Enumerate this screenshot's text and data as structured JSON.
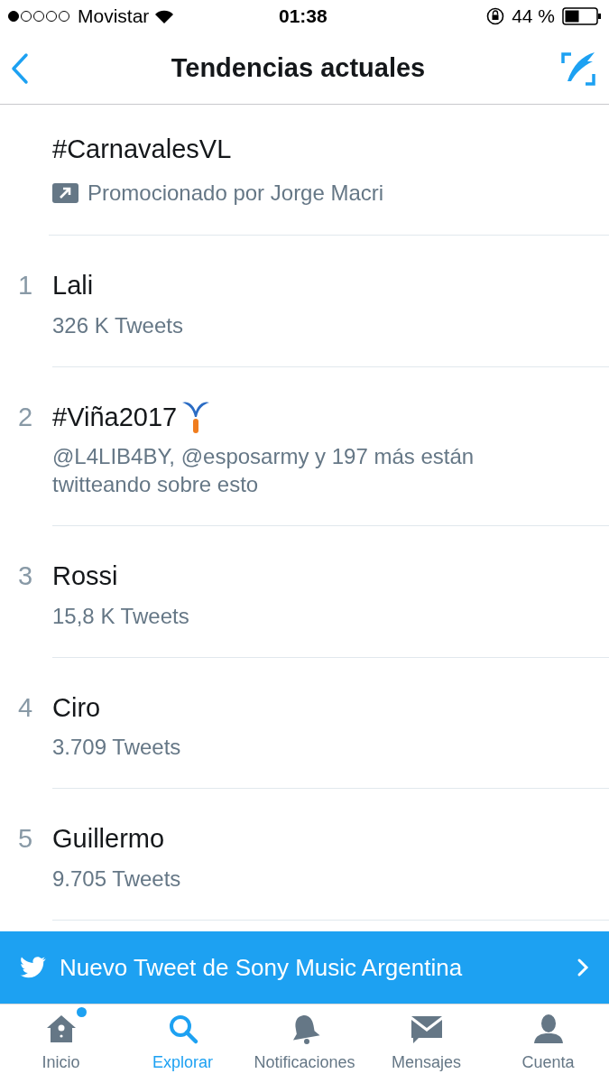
{
  "status_bar": {
    "carrier": "Movistar",
    "time": "01:38",
    "battery": "44 %"
  },
  "nav": {
    "title": "Tendencias actuales"
  },
  "promoted": {
    "title": "#CarnavalesVL",
    "text": "Promocionado por Jorge Macri"
  },
  "trends": [
    {
      "rank": "1",
      "name": "Lali",
      "meta": "326 K Tweets",
      "kind": "plain"
    },
    {
      "rank": "2",
      "name": "#Viña2017",
      "meta": "@L4LIB4BY, @esposarmy y 197 más están twitteando sobre esto",
      "kind": "event"
    },
    {
      "rank": "3",
      "name": "Rossi",
      "meta": "15,8 K Tweets",
      "kind": "plain"
    },
    {
      "rank": "4",
      "name": "Ciro",
      "meta": "3.709 Tweets",
      "kind": "plain"
    },
    {
      "rank": "5",
      "name": "Guillermo",
      "meta": "9.705 Tweets",
      "kind": "plain"
    }
  ],
  "banner": {
    "text": "Nuevo Tweet de Sony Music Argentina"
  },
  "tabs": [
    {
      "label": "Inicio",
      "kind": "home",
      "selected": false,
      "badge": true
    },
    {
      "label": "Explorar",
      "kind": "search",
      "selected": true,
      "badge": false
    },
    {
      "label": "Notificaciones",
      "kind": "bell",
      "selected": false,
      "badge": false
    },
    {
      "label": "Mensajes",
      "kind": "mail",
      "selected": false,
      "badge": false
    },
    {
      "label": "Cuenta",
      "kind": "person",
      "selected": false,
      "badge": false
    }
  ]
}
